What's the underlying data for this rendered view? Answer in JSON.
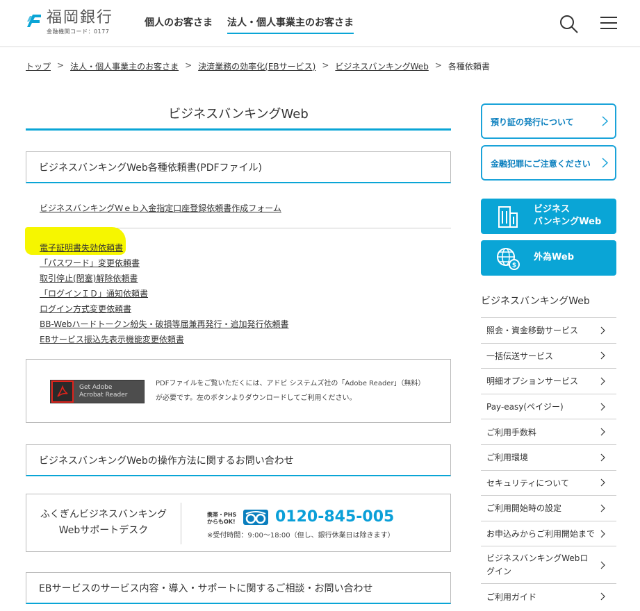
{
  "header": {
    "bank_name": "福岡銀行",
    "bank_code": "金融機関コード：0177",
    "nav_personal": "個人のお客さま",
    "nav_corporate": "法人・個人事業主のお客さま"
  },
  "breadcrumb": {
    "items": [
      "トップ",
      "法人・個人事業主のお客さま",
      "決済業務の効率化(EBサービス)",
      "ビジネスバンキングWeb"
    ],
    "current": "各種依頼書",
    "separator": ">"
  },
  "main": {
    "title": "ビジネスバンキングWeb",
    "section1_heading": "ビジネスバンキングWeb各種依頼書(PDFファイル)",
    "form_link": "ビジネスバンキングＷｅｂ入金指定口座登録依頼書作成フォーム",
    "links": [
      "電子証明書失効依頼書",
      "「パスワード」変更依頼書",
      "取引停止(閉塞)解除依頼書",
      "「ログインＩＤ」通知依頼書",
      "ログイン方式変更依頼書",
      "BB-Webハードトークン紛失・破損等届兼再発行・追加発行依頼書",
      "EBサービス振込先表示機能変更依頼書"
    ],
    "adobe_button_line1": "Get Adobe",
    "adobe_button_line2": "Acrobat Reader",
    "adobe_desc": "PDFファイルをご覧いただくには、アドビ システムズ社の「Adobe Reader」（無料）が必要です。左のボタンよりダウンロードしてご利用ください。",
    "section2_heading": "ビジネスバンキングWebの操作方法に関するお問い合わせ",
    "support_name_line1": "ふくぎんビジネスバンキング",
    "support_name_line2": "Webサポートデスク",
    "phone_note_line1": "携帯・PHS",
    "phone_note_line2": "からもOK!",
    "phone_number": "0120-845-005",
    "phone_hours": "※受付時間：9:00～18:00（但し、銀行休業日は除きます）",
    "section3_heading": "EBサービスのサービス内容・導入・サポートに関するご相談・お問い合わせ"
  },
  "sidebar": {
    "outline_buttons": [
      "預り証の発行について",
      "金融犯罪にご注意ください"
    ],
    "bb_web_line1": "ビジネス",
    "bb_web_line2": "バンキングWeb",
    "fx_web": "外為Web",
    "heading": "ビジネスバンキングWeb",
    "items": [
      "照会・資金移動サービス",
      "一括伝送サービス",
      "明細オプションサービス",
      "Pay-easy(ペイジー)",
      "ご利用手数料",
      "ご利用環境",
      "セキュリティについて",
      "ご利用開始時の設定",
      "お申込みからご利用開始まで",
      "ビジネスバンキングWebログイン",
      "ご利用ガイド"
    ]
  },
  "colors": {
    "accent": "#0aa5d6",
    "highlight": "#f6f600"
  }
}
